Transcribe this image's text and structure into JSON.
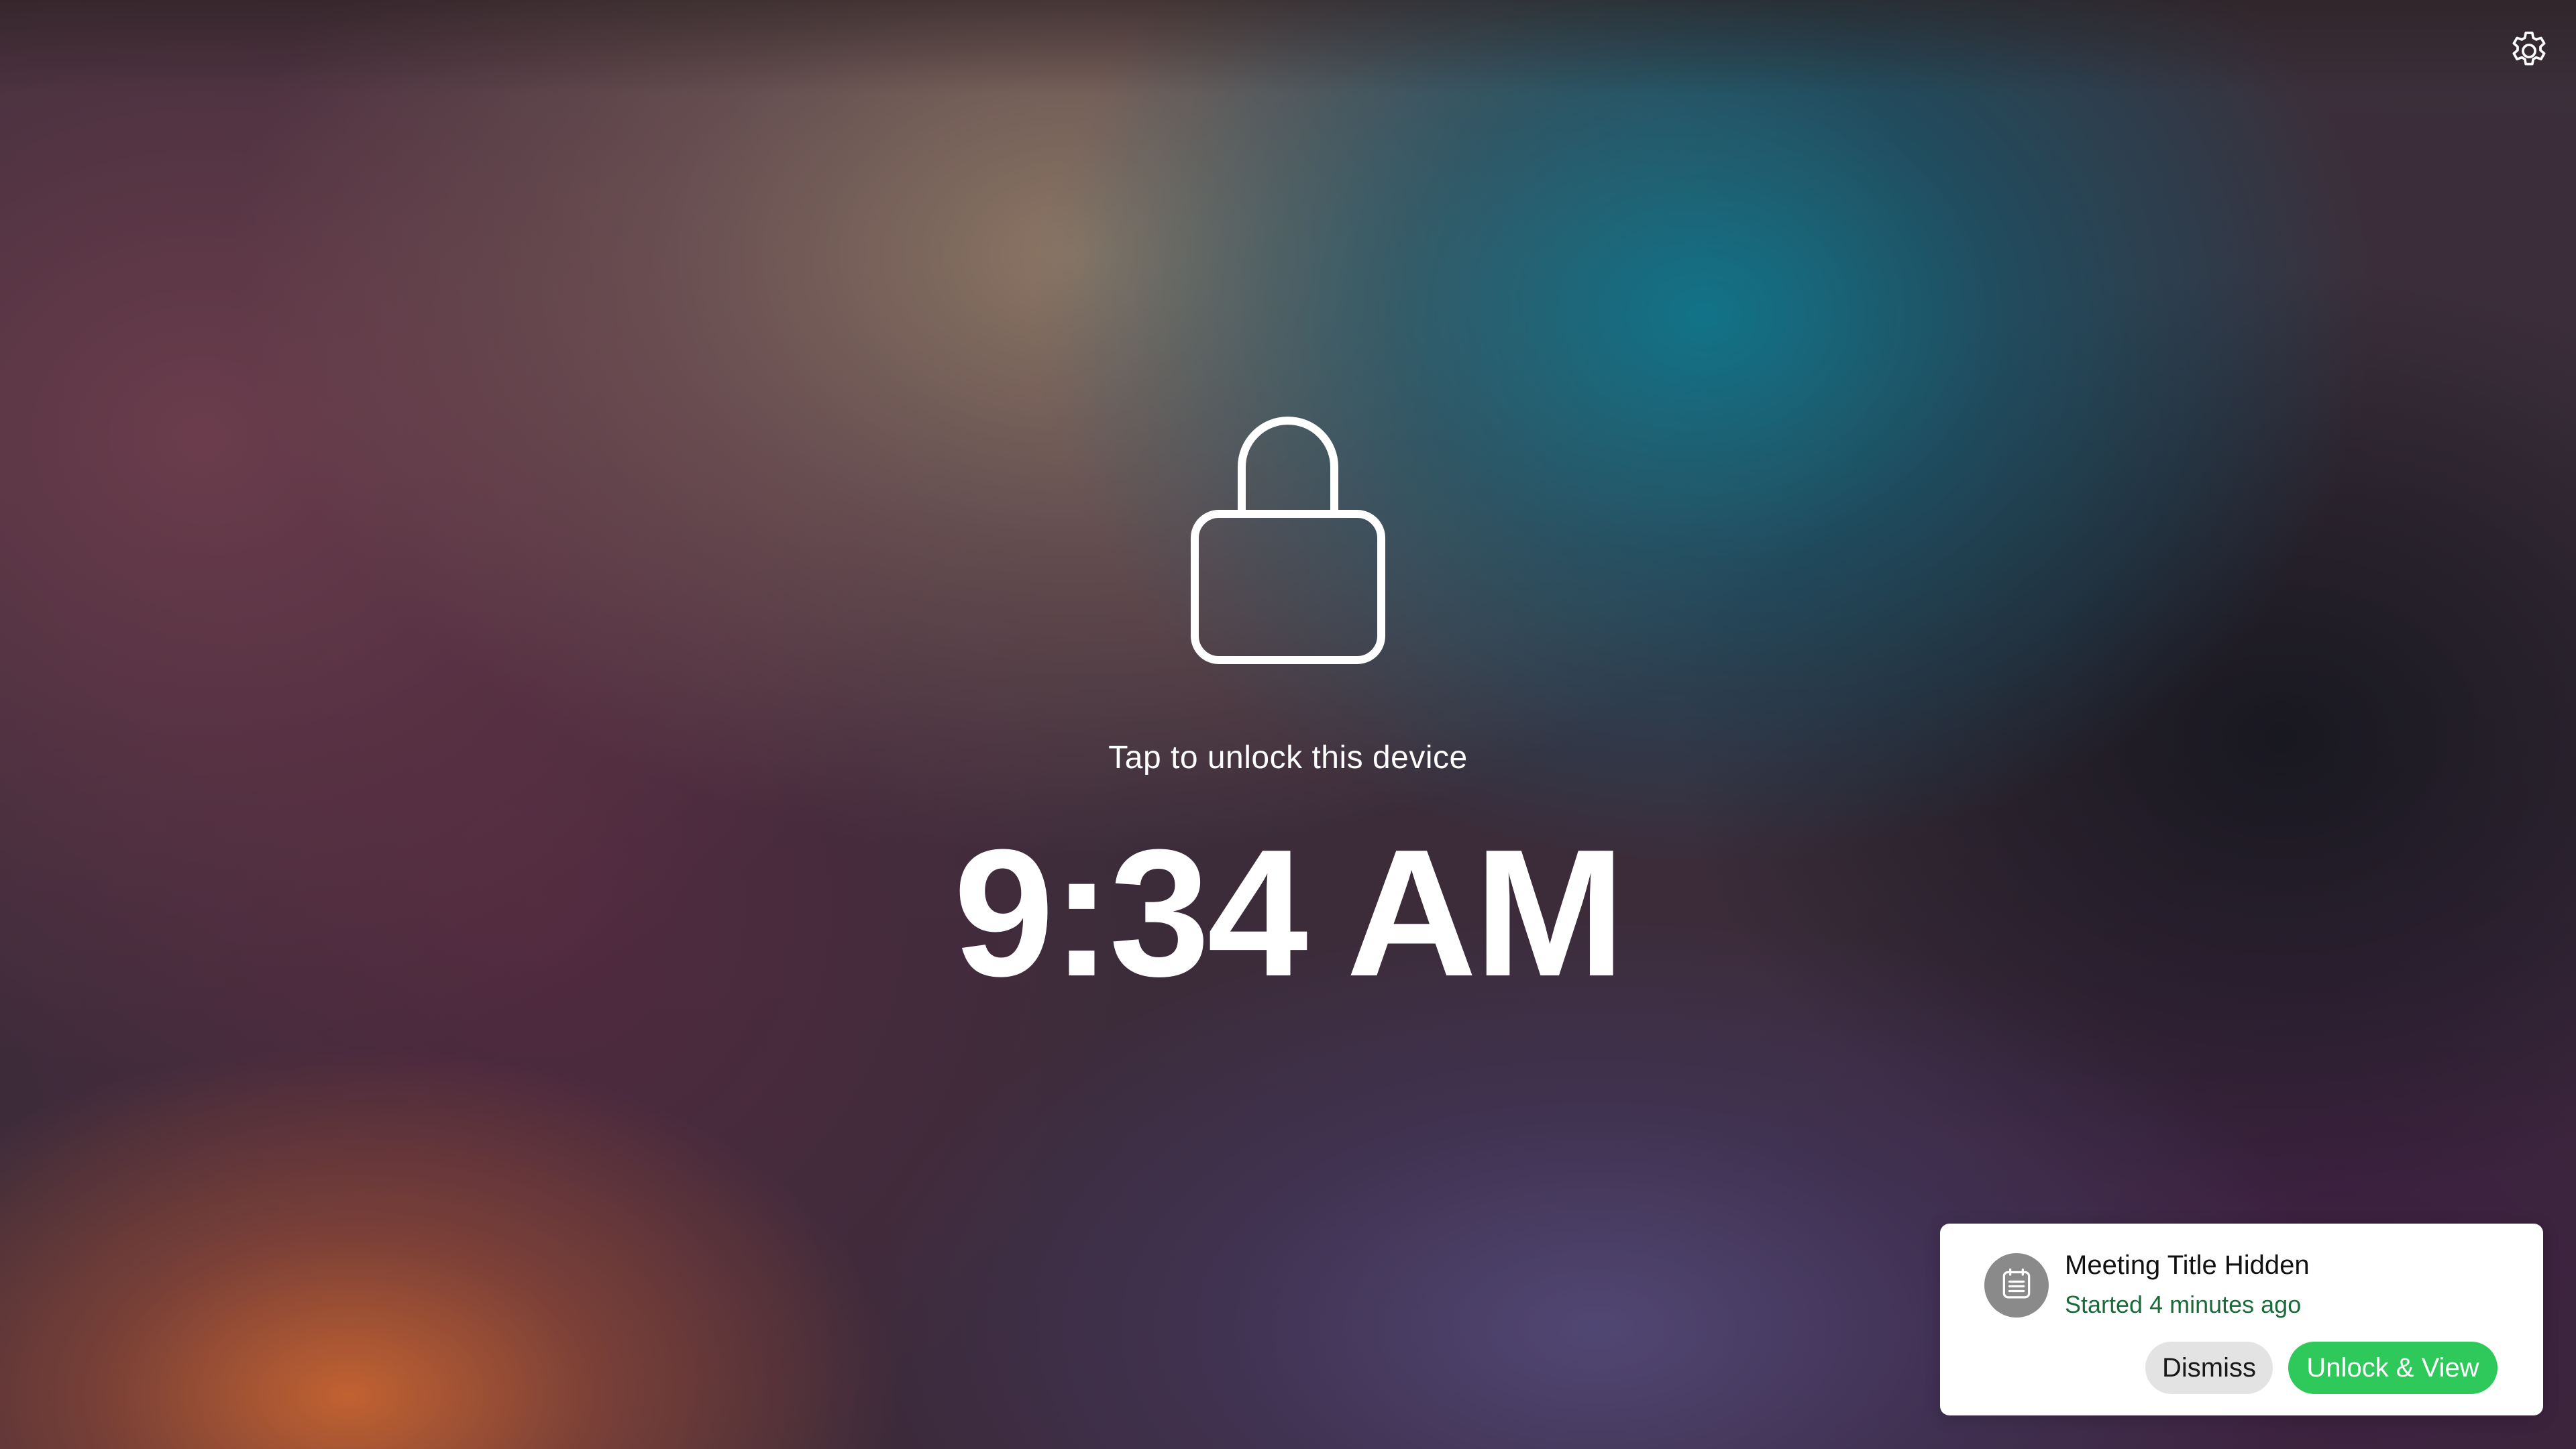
{
  "lock_screen": {
    "unlock_hint": "Tap to unlock this device",
    "time": "9:34 AM"
  },
  "top_bar": {
    "settings_icon": "gear-icon"
  },
  "notification": {
    "icon": "calendar-icon",
    "title": "Meeting Title Hidden",
    "subtitle": "Started 4 minutes ago",
    "dismiss_label": "Dismiss",
    "unlock_view_label": "Unlock & View"
  },
  "colors": {
    "accent_green": "#2fc85a",
    "subtitle_green": "#1b6b3a",
    "dismiss_bg": "#e3e3e3"
  }
}
